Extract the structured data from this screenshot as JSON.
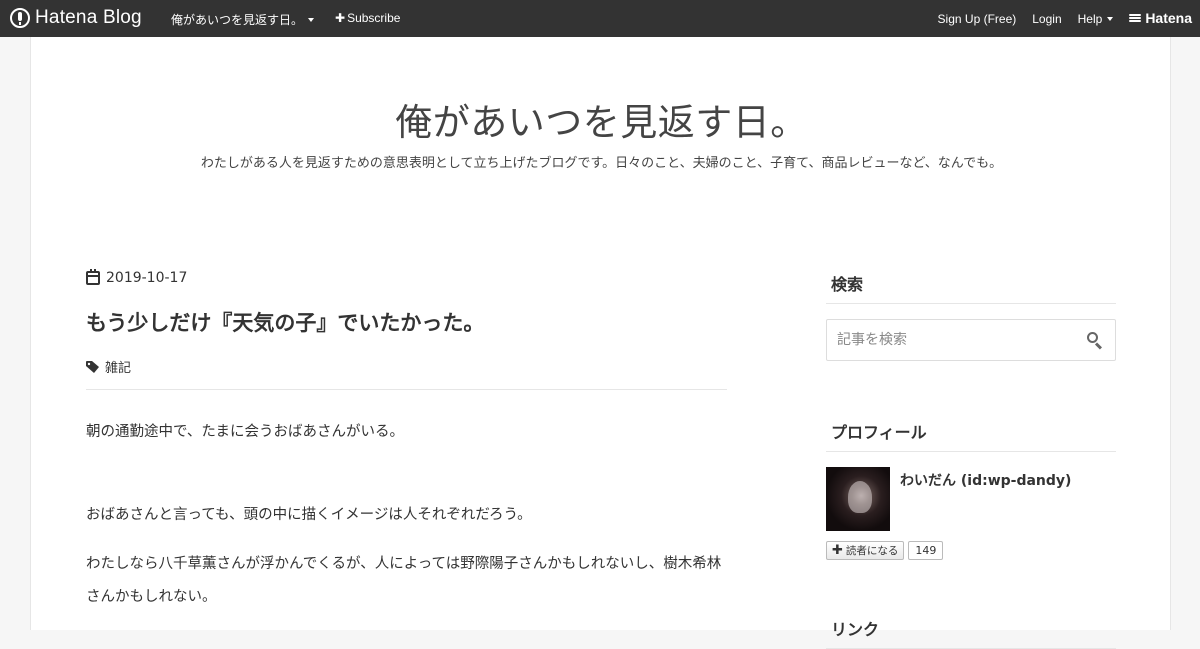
{
  "globalheader": {
    "logo_text": "Hatena Blog",
    "blog_menu_label": "俺があいつを見返す日。",
    "subscribe_label": "Subscribe",
    "signup_label": "Sign Up (Free)",
    "login_label": "Login",
    "help_label": "Help",
    "hatena_label": "Hatena"
  },
  "blog": {
    "title": "俺があいつを見返す日。",
    "description": "わたしがある人を見返すための意思表明として立ち上げたブログです。日々のこと、夫婦のこと、子育て、商品レビューなど、なんでも。"
  },
  "entry": {
    "date": "2019-10-17",
    "title": "もう少しだけ『天気の子』でいたかった。",
    "category": "雑記",
    "paragraphs": [
      "朝の通勤途中で、たまに会うおばあさんがいる。",
      "おばあさんと言っても、頭の中に描くイメージは人それぞれだろう。",
      "わたしなら八千草薫さんが浮かんでくるが、人によっては野際陽子さんかもしれないし、樹木希林さんかもしれない。"
    ]
  },
  "sidebar": {
    "search": {
      "heading": "検索",
      "placeholder": "記事を検索"
    },
    "profile": {
      "heading": "プロフィール",
      "name": "わいだん (id:wp-dandy)",
      "reader_button_label": "読者になる",
      "reader_count": "149"
    },
    "links": {
      "heading": "リンク"
    }
  }
}
